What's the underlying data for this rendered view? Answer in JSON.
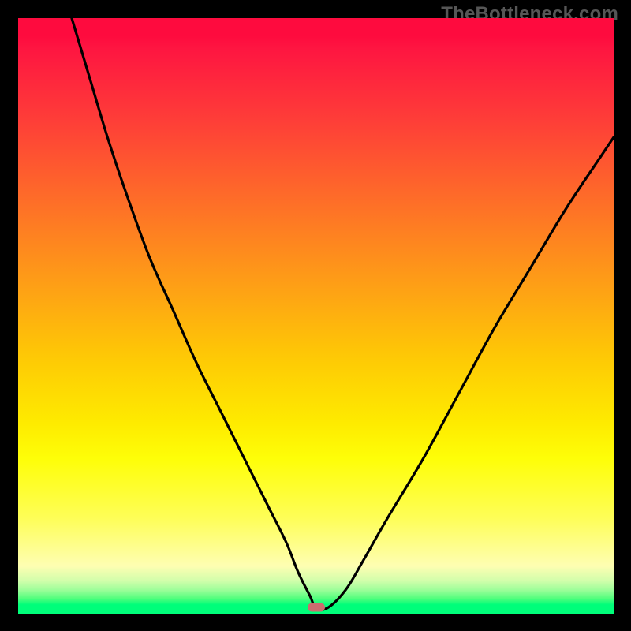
{
  "watermark": "TheBottleneck.com",
  "colors": {
    "gradient_top": "#fe0b3e",
    "gradient_bottom": "#00fe7a",
    "curve": "#000000",
    "marker": "#cc6d6f",
    "frame": "#000000"
  },
  "chart_data": {
    "type": "line",
    "title": "",
    "xlabel": "",
    "ylabel": "",
    "xlim": [
      0,
      100
    ],
    "ylim": [
      0,
      100
    ],
    "grid": false,
    "legend": false,
    "annotations": [],
    "marker": {
      "x": 50,
      "y": 1
    },
    "series": [
      {
        "name": "bottleneck-curve",
        "x": [
          9,
          12,
          15,
          18,
          22,
          26,
          30,
          34,
          38,
          42,
          45,
          47,
          49,
          50,
          52,
          55,
          58,
          62,
          68,
          74,
          80,
          86,
          92,
          98,
          100
        ],
        "values": [
          100,
          90,
          80,
          71,
          60,
          51,
          42,
          34,
          26,
          18,
          12,
          7,
          3,
          1,
          1,
          4,
          9,
          16,
          26,
          37,
          48,
          58,
          68,
          77,
          80
        ]
      }
    ]
  }
}
